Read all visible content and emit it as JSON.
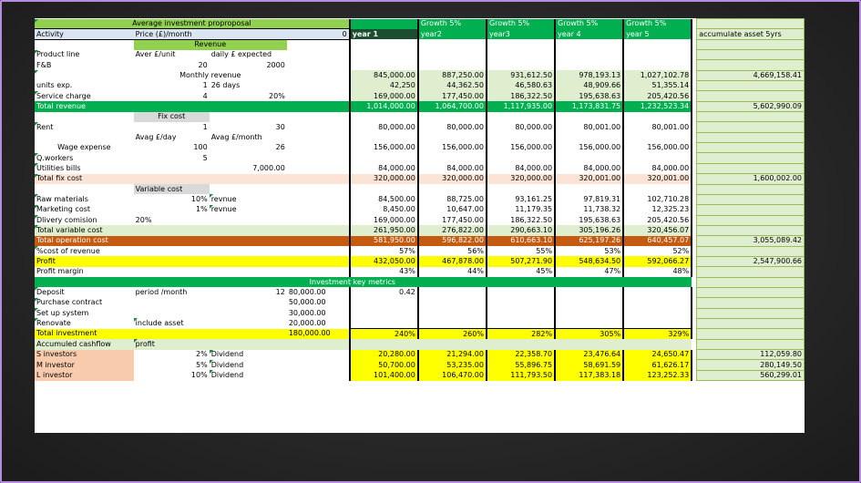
{
  "title": "Average investment proproposal",
  "header": {
    "activity": "Activity",
    "price": "Price (£)/month",
    "zero": "0",
    "growth": [
      "Growth 5%",
      "Growth 5%",
      "Growth 5%",
      "Growth 5%"
    ],
    "years": [
      "year 1",
      "year2",
      "year3",
      "year 4",
      "year 5"
    ],
    "accum": "accumulate asset 5yrs"
  },
  "revenue": {
    "label": "Revenue",
    "product_line": "Product line",
    "aver_unit": "Aver £/unit",
    "daily_expected": "daily £ expected",
    "fb": "F&B",
    "fb_unit": "20",
    "fb_daily": "2000",
    "monthly_label": "Monthly revenue",
    "monthly": [
      "845,000.00",
      "887,250.00",
      "931,612.50",
      "978,193.13",
      "1,027,102.78"
    ],
    "monthly_total": "4,669,158.41",
    "units_exp": "units exp.",
    "units_val": "1",
    "units_days": "26 days",
    "units": [
      "42,250",
      "44,362.50",
      "46,580.63",
      "48,909.66",
      "51,355.14"
    ],
    "service": "Service  charge",
    "service_val": "4",
    "service_pct": "20%",
    "service_vals": [
      "169,000.00",
      "177,450.00",
      "186,322.50",
      "195,638.63",
      "205,420.56"
    ],
    "total_label": "Total revenue",
    "total": [
      "1,014,000.00",
      "1,064,700.00",
      "1,117,935.00",
      "1,173,831.75",
      "1,232,523.34"
    ],
    "total_accum": "5,602,990.09"
  },
  "fix": {
    "label": "Fix cost",
    "rent": "Rent",
    "rent_val": "1",
    "rent_mult": "30",
    "rent_vals": [
      "80,000.00",
      "80,000.00",
      "80,000.00",
      "80,001.00",
      "80,001.00"
    ],
    "avg_day": "Avag £/day",
    "avg_month": "Avag £/month",
    "wage": "Wage expense",
    "wage_day": "100",
    "wage_month": "26",
    "wage_vals": [
      "156,000.00",
      "156,000.00",
      "156,000.00",
      "156,000.00",
      "156,000.00"
    ],
    "workers": "Q.workers",
    "workers_val": "5",
    "util": "Utilities bills",
    "util_val": "7,000.00",
    "util_vals": [
      "84,000.00",
      "84,000.00",
      "84,000.00",
      "84,000.00",
      "84,000.00"
    ],
    "total_label": "Total fix cost",
    "total": [
      "320,000.00",
      "320,000.00",
      "320,000.00",
      "320,001.00",
      "320,001.00"
    ],
    "total_accum": "1,600,002.00"
  },
  "variable": {
    "label": "Variable cost",
    "raw": "Raw materials",
    "raw_pct": "10%",
    "raw_of": "revnue",
    "raw_vals": [
      "84,500.00",
      "88,725.00",
      "93,161.25",
      "97,819.31",
      "102,710.28"
    ],
    "mkt": "Marketing cost",
    "mkt_pct": "1%",
    "mkt_of": "revnue",
    "mkt_vals": [
      "8,450.00",
      "10,647.00",
      "11,179.35",
      "11,738.32",
      "12,325.23"
    ],
    "dlv": "Dlivery comision",
    "dlv_pct": "20%",
    "dlv_vals": [
      "169,000.00",
      "177,450.00",
      "186,322.50",
      "195,638.63",
      "205,420.56"
    ],
    "total_label": "Total variable cost",
    "total": [
      "261,950.00",
      "276,822.00",
      "290,663.10",
      "305,196.26",
      "320,456.07"
    ]
  },
  "operation": {
    "label": "Total operation cost",
    "vals": [
      "581,950.00",
      "596,822.00",
      "610,663.10",
      "625,197.26",
      "640,457.07"
    ],
    "accum": "3,055,089.42",
    "pct_label": "%cost of revenue",
    "pct": [
      "57%",
      "56%",
      "55%",
      "53%",
      "52%"
    ]
  },
  "profit": {
    "label": "Profit",
    "vals": [
      "432,050.00",
      "467,878.00",
      "507,271.90",
      "548,634.50",
      "592,066.27"
    ],
    "accum": "2,547,900.66",
    "margin_label": "Profit margin",
    "margin": [
      "43%",
      "44%",
      "45%",
      "47%",
      "48%"
    ]
  },
  "investment": {
    "label": "Investment  key metrics",
    "deposit": "Deposit",
    "period": "period /month",
    "months": "12",
    "deposit_val": "80,000.00",
    "ratio": "0.42",
    "purchase": "Purchase contract",
    "purchase_val": "50,000.00",
    "setup": "Set up system",
    "setup_val": "30,000.00",
    "renovate": "Renovate",
    "renovate_note": "include asset",
    "renovate_val": "20,000.00",
    "total_label": "Total investment",
    "total": "180,000.00",
    "pcts": [
      "240%",
      "260%",
      "282%",
      "305%",
      "329%"
    ]
  },
  "cashflow": {
    "label": "Accumuled cashflow",
    "profit": "profit",
    "investors": [
      {
        "name": "S investors",
        "pct": "2%",
        "type": "Dividend",
        "vals": [
          "20,280.00",
          "21,294.00",
          "22,358.70",
          "23,476.64",
          "24,650.47"
        ],
        "total": "112,059.80"
      },
      {
        "name": "M investor",
        "pct": "5%",
        "type": "Dividend",
        "vals": [
          "50,700.00",
          "53,235.00",
          "55,896.75",
          "58,691.59",
          "61,626.17"
        ],
        "total": "280,149.50"
      },
      {
        "name": "L investor",
        "pct": "10%",
        "type": "Dividend",
        "vals": [
          "101,400.00",
          "106,470.00",
          "111,793.50",
          "117,383.18",
          "123,252.33"
        ],
        "total": "560,299.01"
      }
    ]
  },
  "colors": {
    "header_dark": "#1b4d2e",
    "green": "#00b050",
    "light_green": "#92d050",
    "orange": "#c55a11",
    "yellow": "#ffff00",
    "frame": "#b78be0"
  }
}
